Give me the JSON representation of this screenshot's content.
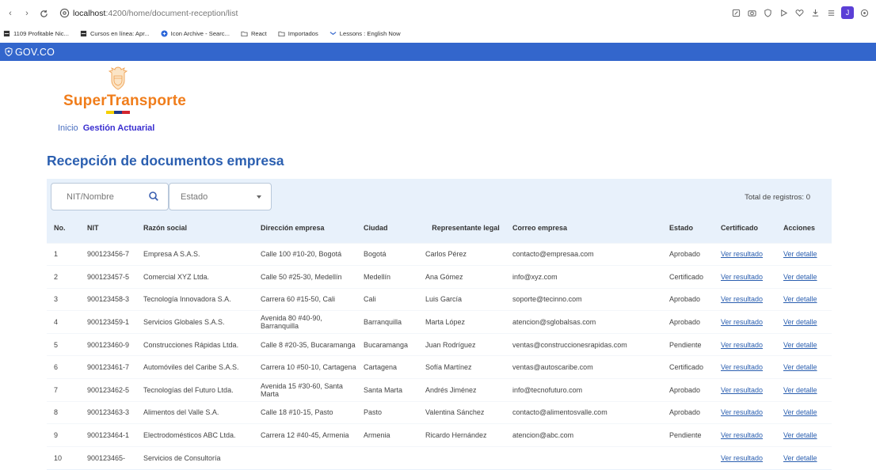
{
  "browser": {
    "url_host": "localhost",
    "url_path": ":4200/home/document-reception/list",
    "avatar_letter": "J",
    "bookmarks": [
      {
        "label": "1109 Profitable Nic...",
        "icon": "bookmark-icon",
        "color": "#333333"
      },
      {
        "label": "Cursos en línea: Apr...",
        "icon": "bookmark-icon",
        "color": "#333333"
      },
      {
        "label": "Icon Archive - Searc...",
        "icon": "icon-archive-icon",
        "color": "#2b66d9"
      },
      {
        "label": "React",
        "icon": "folder-icon",
        "color": "#555555"
      },
      {
        "label": "Importados",
        "icon": "folder-icon",
        "color": "#555555"
      },
      {
        "label": "Lessons : English Now",
        "icon": "lessons-icon",
        "color": "#3366cc"
      }
    ]
  },
  "gov": {
    "label": "GOV.CO"
  },
  "brand": {
    "logo_text": "SuperTransporte",
    "accent": "#f07d1b",
    "flag": [
      "#f5d000",
      "#1e3a8a",
      "#d22630"
    ]
  },
  "breadcrumb": {
    "home": "Inicio",
    "current": "Gestión Actuarial"
  },
  "page": {
    "title": "Recepción de documentos empresa"
  },
  "filters": {
    "search_placeholder": "NIT/Nombre",
    "estado_placeholder": "Estado",
    "total_label": "Total de registros: 0"
  },
  "table": {
    "headers": {
      "no": "No.",
      "nit": "NIT",
      "razon": "Razón social",
      "direccion": "Dirección empresa",
      "ciudad": "Ciudad",
      "representante": "Representante legal",
      "correo": "Correo empresa",
      "estado": "Estado",
      "certificado": "Certificado",
      "acciones": "Acciones"
    },
    "link_certificado": "Ver resultado",
    "link_acciones": "Ver detalle",
    "rows": [
      {
        "no": "1",
        "nit": "900123456-7",
        "razon": "Empresa A S.A.S.",
        "direccion": "Calle 100 #10-20, Bogotá",
        "ciudad": "Bogotá",
        "representante": "Carlos Pérez",
        "correo": "contacto@empresaa.com",
        "estado": "Aprobado"
      },
      {
        "no": "2",
        "nit": "900123457-5",
        "razon": "Comercial XYZ Ltda.",
        "direccion": "Calle 50 #25-30, Medellín",
        "ciudad": "Medellín",
        "representante": "Ana Gómez",
        "correo": "info@xyz.com",
        "estado": "Certificado"
      },
      {
        "no": "3",
        "nit": "900123458-3",
        "razon": "Tecnología Innovadora S.A.",
        "direccion": "Carrera 60 #15-50, Cali",
        "ciudad": "Cali",
        "representante": "Luis García",
        "correo": "soporte@tecinno.com",
        "estado": "Aprobado"
      },
      {
        "no": "4",
        "nit": "900123459-1",
        "razon": "Servicios Globales S.A.S.",
        "direccion": "Avenida 80 #40-90, Barranquilla",
        "ciudad": "Barranquilla",
        "representante": "Marta López",
        "correo": "atencion@sglobalsas.com",
        "estado": "Aprobado"
      },
      {
        "no": "5",
        "nit": "900123460-9",
        "razon": "Construcciones Rápidas Ltda.",
        "direccion": "Calle 8 #20-35, Bucaramanga",
        "ciudad": "Bucaramanga",
        "representante": "Juan Rodríguez",
        "correo": "ventas@construccionesrapidas.com",
        "estado": "Pendiente"
      },
      {
        "no": "6",
        "nit": "900123461-7",
        "razon": "Automóviles del Caribe S.A.S.",
        "direccion": "Carrera 10 #50-10, Cartagena",
        "ciudad": "Cartagena",
        "representante": "Sofía Martínez",
        "correo": "ventas@autoscaribe.com",
        "estado": "Certificado"
      },
      {
        "no": "7",
        "nit": "900123462-5",
        "razon": "Tecnologías del Futuro Ltda.",
        "direccion": "Avenida 15 #30-60, Santa Marta",
        "ciudad": "Santa Marta",
        "representante": "Andrés Jiménez",
        "correo": "info@tecnofuturo.com",
        "estado": "Aprobado"
      },
      {
        "no": "8",
        "nit": "900123463-3",
        "razon": "Alimentos del Valle S.A.",
        "direccion": "Calle 18 #10-15, Pasto",
        "ciudad": "Pasto",
        "representante": "Valentina Sánchez",
        "correo": "contacto@alimentosvalle.com",
        "estado": "Aprobado"
      },
      {
        "no": "9",
        "nit": "900123464-1",
        "razon": "Electrodomésticos ABC Ltda.",
        "direccion": "Carrera 12 #40-45, Armenia",
        "ciudad": "Armenia",
        "representante": "Ricardo Hernández",
        "correo": "atencion@abc.com",
        "estado": "Pendiente"
      },
      {
        "no": "10",
        "nit": "900123465-",
        "razon": "Servicios de Consultoría",
        "direccion": "",
        "ciudad": "",
        "representante": "",
        "correo": "",
        "estado": ""
      }
    ]
  }
}
